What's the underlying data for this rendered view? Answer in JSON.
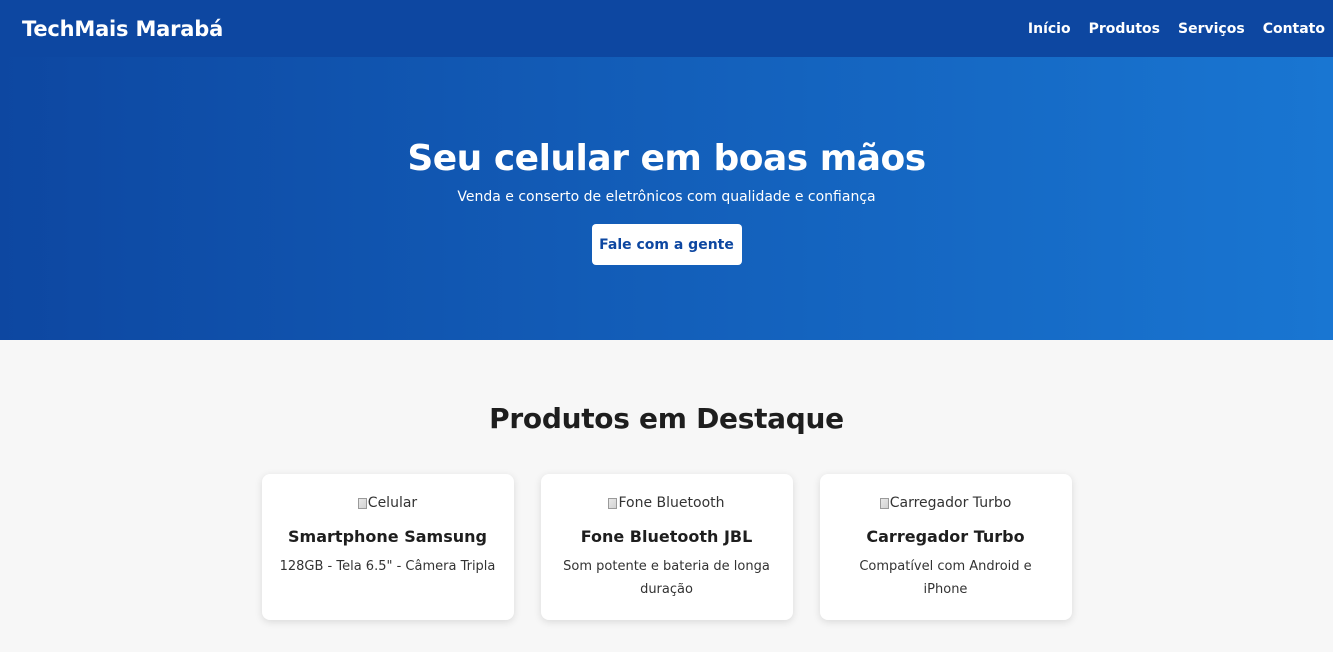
{
  "header": {
    "brand": "TechMais Marabá",
    "nav": [
      {
        "label": "Início"
      },
      {
        "label": "Produtos"
      },
      {
        "label": "Serviços"
      },
      {
        "label": "Contato"
      }
    ]
  },
  "hero": {
    "title": "Seu celular em boas mãos",
    "subtitle": "Venda e conserto de eletrônicos com qualidade e confiança",
    "cta_label": "Fale com a gente"
  },
  "products": {
    "heading": "Produtos em Destaque",
    "items": [
      {
        "image_alt": "Celular",
        "name": "Smartphone Samsung",
        "description": "128GB - Tela 6.5\" - Câmera Tripla"
      },
      {
        "image_alt": "Fone Bluetooth",
        "name": "Fone Bluetooth JBL",
        "description": "Som potente e bateria de longa duração"
      },
      {
        "image_alt": "Carregador Turbo",
        "name": "Carregador Turbo",
        "description": "Compatível com Android e iPhone"
      }
    ]
  },
  "colors": {
    "primary": "#0d47a1",
    "primary_light": "#1976d2",
    "background": "#f7f7f7",
    "card": "#ffffff"
  },
  "icons": {
    "broken_image": "broken-image-icon"
  }
}
